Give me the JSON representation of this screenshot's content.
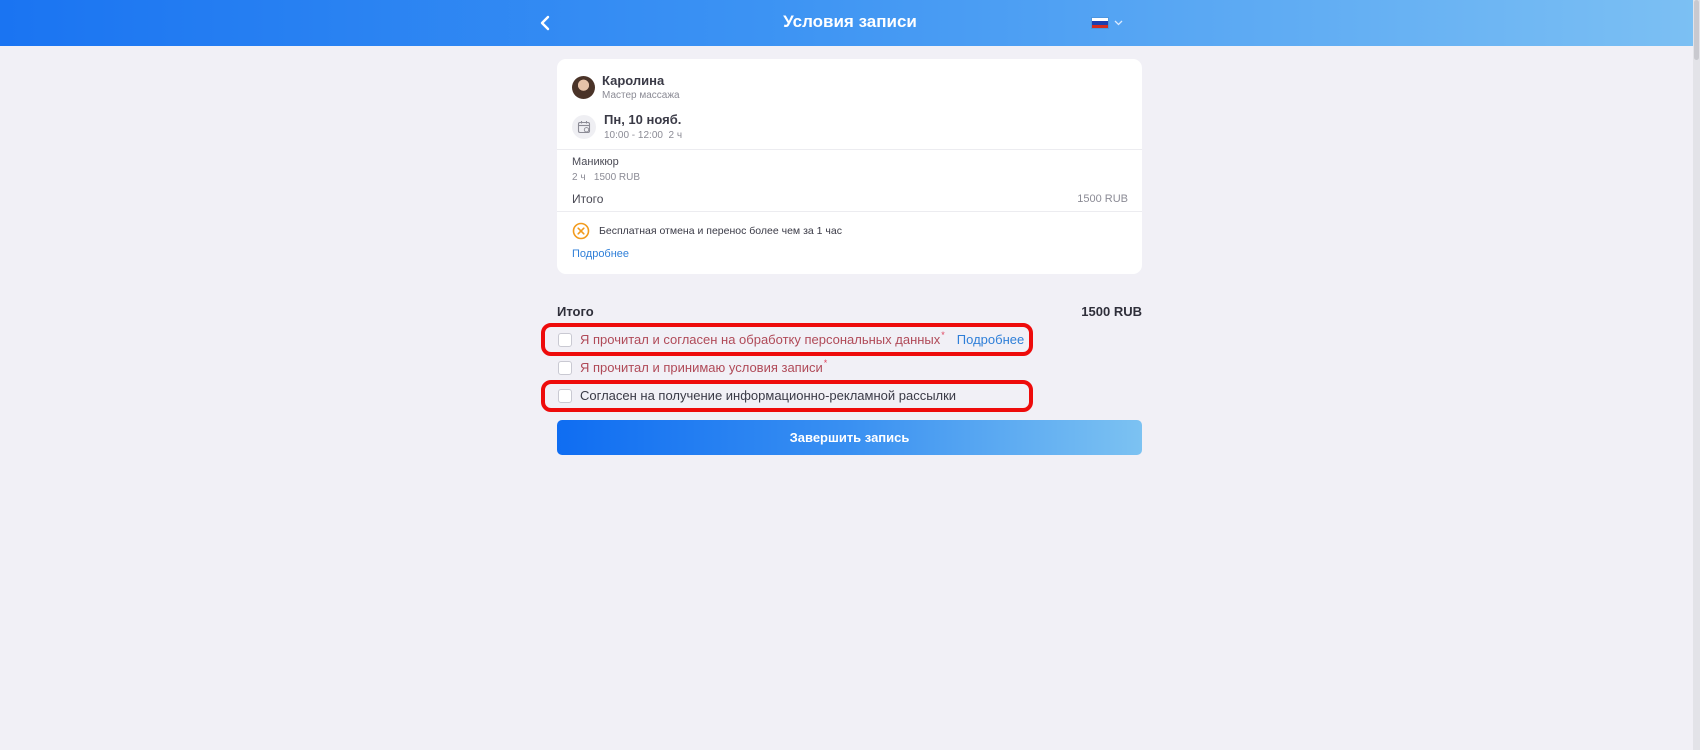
{
  "header": {
    "title": "Условия записи",
    "language_icon": "flag-ru-icon",
    "colors": {
      "gradient_start": "#1a74f2",
      "gradient_end": "#7cc0f3"
    }
  },
  "booking": {
    "master": {
      "name": "Каролина",
      "role": "Мастер массажа"
    },
    "date": {
      "day": "Пн, 10 нояб.",
      "time": "10:00 - 12:00",
      "duration": "2 ч"
    },
    "service": {
      "name": "Маникюр",
      "duration": "2 ч",
      "price": "1500 RUB"
    },
    "total_label": "Итого",
    "total_value": "1500 RUB",
    "policy": {
      "text": "Бесплатная отмена и перенос более чем за 1 час",
      "link": "Подробнее"
    }
  },
  "summary": {
    "total_label": "Итого",
    "total_value": "1500 RUB"
  },
  "consents": [
    {
      "text": "Я прочитал и согласен на обработку персональных данных",
      "required_mark": "*",
      "link": "Подробнее",
      "checked": false
    },
    {
      "text": "Я прочитал и принимаю условия записи",
      "required_mark": "*",
      "checked": false
    },
    {
      "text": "Согласен на получение информационно-рекламной рассылки",
      "checked": false
    }
  ],
  "submit_label": "Завершить запись",
  "accent_color": "#2f7fd8",
  "highlight_color": "#ee0b0b"
}
